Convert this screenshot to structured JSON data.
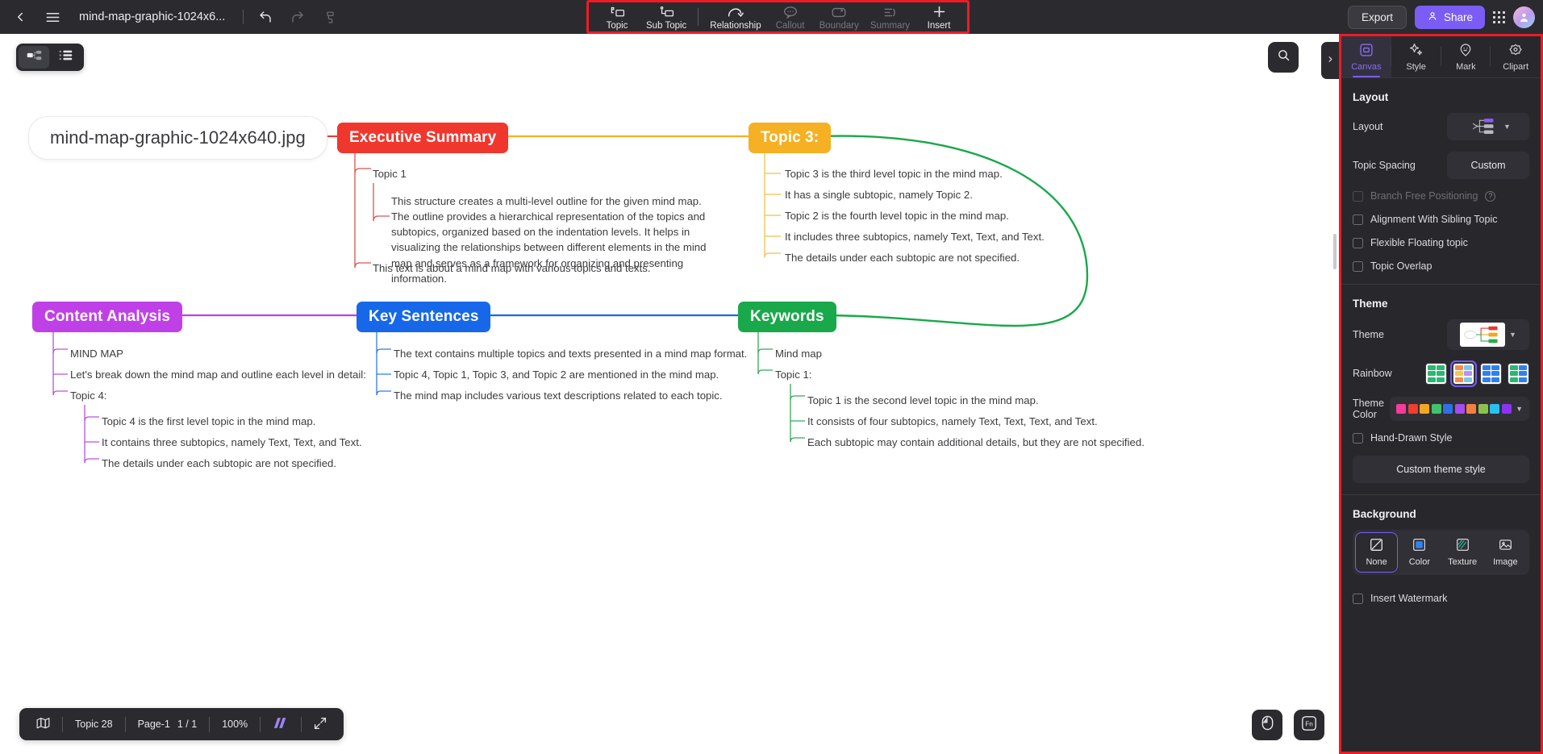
{
  "topbar": {
    "back_icon": "chevron-left-icon",
    "menu_icon": "hamburger-menu-icon",
    "doc_title": "mind-map-graphic-1024x6...",
    "undo_icon": "undo-arrow-icon",
    "redo_icon": "redo-arrow-icon",
    "format_painter_icon": "format-painter-icon",
    "export_label": "Export",
    "share_label": "Share",
    "apps_icon": "apps-grid-icon",
    "avatar_icon": "user-avatar-icon",
    "tools": [
      {
        "label": "Topic",
        "icon": "topic-icon",
        "disabled": false
      },
      {
        "label": "Sub Topic",
        "icon": "sub-topic-icon",
        "disabled": false
      },
      {
        "label": "Relationship",
        "icon": "relationship-arc-icon",
        "disabled": false
      },
      {
        "label": "Callout",
        "icon": "callout-bubble-icon",
        "disabled": true
      },
      {
        "label": "Boundary",
        "icon": "boundary-icon",
        "disabled": true
      },
      {
        "label": "Summary",
        "icon": "summary-bracket-icon",
        "disabled": true
      },
      {
        "label": "Insert",
        "icon": "plus-icon",
        "disabled": false
      }
    ]
  },
  "canvas_controls": {
    "mindmap_view_icon": "mindmap-view-icon",
    "outline_view_icon": "outline-list-icon",
    "search_icon": "search-icon",
    "panel_toggle_icon": "chevron-right-icon"
  },
  "mindmap": {
    "root": {
      "label": "mind-map-graphic-1024x640.jpg"
    },
    "branches": [
      {
        "title": "Executive Summary",
        "color": "#f0372e",
        "children": [
          {
            "text": "Topic 1"
          },
          {
            "text": "This structure creates a multi-level outline for the given mind map. The outline provides a hierarchical representation of the topics and subtopics, organized based on the indentation levels. It helps in visualizing the relationships between different elements in the mind map and serves as a framework for organizing and presenting information."
          },
          {
            "text": "This text is about a mind map with various topics and texts."
          }
        ]
      },
      {
        "title": "Topic 3:",
        "color": "#f5b123",
        "children": [
          {
            "text": "Topic 3 is the third level topic in the mind map."
          },
          {
            "text": "It has a single subtopic, namely Topic 2."
          },
          {
            "text": "Topic 2 is the fourth level topic in the mind map."
          },
          {
            "text": "It includes three subtopics, namely Text, Text, and Text."
          },
          {
            "text": "The details under each subtopic are not specified."
          }
        ]
      },
      {
        "title": "Content Analysis",
        "color": "#c040e8",
        "children": [
          {
            "text": "MIND MAP"
          },
          {
            "text": "Let's break down the mind map and outline each level in detail:"
          },
          {
            "text": "Topic 4:"
          },
          {
            "text": "Topic 4 is the first level topic in the mind map."
          },
          {
            "text": "It contains three subtopics, namely Text, Text, and Text."
          },
          {
            "text": "The details under each subtopic are not specified."
          }
        ]
      },
      {
        "title": "Key Sentences",
        "color": "#1768e8",
        "children": [
          {
            "text": "The text contains multiple topics and texts presented in a mind map format."
          },
          {
            "text": "Topic 4, Topic 1, Topic 3, and Topic 2 are mentioned in the mind map."
          },
          {
            "text": "The mind map includes various text descriptions related to each topic."
          }
        ]
      },
      {
        "title": "Keywords",
        "color": "#19a84a",
        "children": [
          {
            "text": "Mind map"
          },
          {
            "text": "Topic 1:"
          },
          {
            "text": "Topic 1 is the second level topic in the mind map."
          },
          {
            "text": "It consists of four subtopics, namely Text, Text, Text, and Text."
          },
          {
            "text": "Each subtopic may contain additional details, but they are not specified."
          }
        ]
      }
    ]
  },
  "statusbar": {
    "map_icon": "map-outline-icon",
    "topic_count": "Topic 28",
    "page_label": "Page-1",
    "page_index": "1 / 1",
    "zoom": "100%",
    "ai_icon": "ai-sparkle-icon",
    "fullscreen_icon": "fullscreen-expand-icon",
    "mouse_mode_icon": "mouse-pointer-icon",
    "fn_key_icon": "fn-key-icon"
  },
  "right_panel": {
    "tabs": [
      {
        "label": "Canvas",
        "icon": "canvas-frame-icon",
        "active": true
      },
      {
        "label": "Style",
        "icon": "style-sparkle-icon",
        "active": false
      },
      {
        "label": "Mark",
        "icon": "mark-smiley-pin-icon",
        "active": false
      },
      {
        "label": "Clipart",
        "icon": "clipart-flower-icon",
        "active": false
      }
    ],
    "layout_section": {
      "heading": "Layout",
      "layout_label": "Layout",
      "layout_thumb_icon": "layout-tree-thumbnail",
      "topic_spacing_label": "Topic Spacing",
      "topic_spacing_value": "Custom",
      "checkboxes": [
        {
          "label": "Branch Free Positioning",
          "checked": false,
          "disabled": true,
          "has_help": true
        },
        {
          "label": "Alignment With Sibling Topic",
          "checked": false,
          "disabled": false,
          "has_help": false
        },
        {
          "label": "Flexible Floating topic",
          "checked": false,
          "disabled": false,
          "has_help": false
        },
        {
          "label": "Topic Overlap",
          "checked": false,
          "disabled": false,
          "has_help": false
        }
      ]
    },
    "theme_section": {
      "heading": "Theme",
      "theme_label": "Theme",
      "theme_thumb_icon": "theme-preview-thumbnail",
      "rainbow_label": "Rainbow",
      "rainbow_selected_index": 1,
      "rainbow_swatches": [
        [
          "#2bb673",
          "#2bb673",
          "#2bb673",
          "#2bb673",
          "#2bb673",
          "#2bb673"
        ],
        [
          "#f58b4c",
          "#7dc8e8",
          "#f2c94c",
          "#b98ff0",
          "#f58b4c",
          "#7dc8e8"
        ],
        [
          "#2f80ed",
          "#2f80ed",
          "#2f80ed",
          "#2f80ed",
          "#2f80ed",
          "#2f80ed"
        ],
        [
          "#2bb673",
          "#2f80ed",
          "#2bb673",
          "#2f80ed",
          "#2bb673",
          "#2f80ed"
        ]
      ],
      "theme_color_label": "Theme Color",
      "theme_colors": [
        "#f73b9a",
        "#f03e2f",
        "#f5a623",
        "#3ec46d",
        "#2f6fe8",
        "#a54bf0",
        "#f5803e",
        "#8bc34a",
        "#29c2f0",
        "#8b33f5"
      ],
      "hand_drawn_label": "Hand-Drawn Style",
      "hand_drawn_checked": false,
      "custom_theme_label": "Custom theme style"
    },
    "background_section": {
      "heading": "Background",
      "options": [
        {
          "label": "None",
          "icon": "none-slash-icon",
          "selected": true
        },
        {
          "label": "Color",
          "icon": "color-square-icon",
          "selected": false
        },
        {
          "label": "Texture",
          "icon": "texture-hatch-icon",
          "selected": false
        },
        {
          "label": "Image",
          "icon": "image-picture-icon",
          "selected": false
        }
      ],
      "watermark_label": "Insert Watermark",
      "watermark_checked": false
    }
  }
}
